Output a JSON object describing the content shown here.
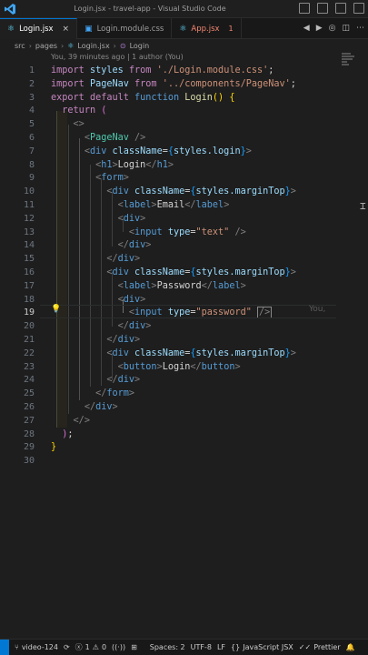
{
  "window": {
    "title": "Login.jsx - travel-app - Visual Studio Code"
  },
  "tabs": [
    {
      "label": "Login.jsx",
      "icon": "react-icon",
      "active": true,
      "close": "×"
    },
    {
      "label": "Login.module.css",
      "icon": "css-icon",
      "active": false
    },
    {
      "label": "App.jsx",
      "icon": "react-icon",
      "active": false,
      "problems": "1"
    }
  ],
  "breadcrumb": [
    "src",
    "pages",
    "Login.jsx",
    "Login"
  ],
  "blame_header": "You, 39 minutes ago | 1 author (You)",
  "code": {
    "current_line": 19,
    "inline_blame": "You,",
    "lines": [
      {
        "n": "1"
      },
      {
        "n": "2"
      },
      {
        "n": "3"
      },
      {
        "n": "4"
      },
      {
        "n": "5"
      },
      {
        "n": "6"
      },
      {
        "n": "7"
      },
      {
        "n": "8"
      },
      {
        "n": "9"
      },
      {
        "n": "10"
      },
      {
        "n": "11"
      },
      {
        "n": "12"
      },
      {
        "n": "13"
      },
      {
        "n": "14"
      },
      {
        "n": "15"
      },
      {
        "n": "16"
      },
      {
        "n": "17"
      },
      {
        "n": "18"
      },
      {
        "n": "19"
      },
      {
        "n": "20"
      },
      {
        "n": "21"
      },
      {
        "n": "22"
      },
      {
        "n": "23"
      },
      {
        "n": "24"
      },
      {
        "n": "25"
      },
      {
        "n": "26"
      },
      {
        "n": "27"
      },
      {
        "n": "28"
      },
      {
        "n": "29"
      },
      {
        "n": "30"
      }
    ],
    "tokens": {
      "import": "import",
      "from": "from",
      "export": "export",
      "default": "default",
      "function": "function",
      "return": "return",
      "styles": "styles",
      "PageNav": "PageNav",
      "Login": "Login",
      "login_css_path": "'./Login.module.css'",
      "pagenav_path": "'../components/PageNav'",
      "className": "className",
      "type": "type",
      "styles_login": "styles.login",
      "styles_marginTop": "styles.marginTop",
      "h1": "h1",
      "form": "form",
      "div": "div",
      "label": "label",
      "input": "input",
      "button": "button",
      "email_text": "Email",
      "password_text": "Password",
      "login_text": "Login",
      "text_value": "\"text\"",
      "password_value": "\"password\""
    }
  },
  "statusbar": {
    "branch": "video-124",
    "errors": "1",
    "warnings": "0",
    "spaces": "Spaces: 2",
    "encoding": "UTF-8",
    "eol": "LF",
    "language": "JavaScript JSX",
    "formatter": "Prettier"
  },
  "colors": {
    "accent": "#0078d4",
    "error": "#f48771"
  }
}
